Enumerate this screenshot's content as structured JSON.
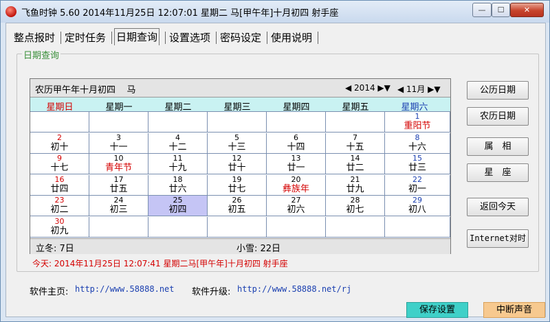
{
  "titlebar": {
    "title": "飞鱼时钟 5.60 2014年11月25日 12:07:01 星期二 马[甲午年]十月初四 射手座",
    "min": "—",
    "max": "☐",
    "close": "✕"
  },
  "tabs": [
    "整点报时",
    "定时任务",
    "日期查询",
    "设置选项",
    "密码设定",
    "使用说明"
  ],
  "active_tab": "日期查询",
  "group_title": "日期查询",
  "calendar": {
    "lunar_header": "农历甲午年十月初四",
    "zodiac": "马",
    "year": "2014",
    "month": "11月",
    "weekdays": [
      "星期日",
      "星期一",
      "星期二",
      "星期三",
      "星期四",
      "星期五",
      "星期六"
    ],
    "rows": [
      [
        null,
        null,
        null,
        null,
        null,
        null,
        {
          "d": "1",
          "l": "重阳节",
          "fest": true
        }
      ],
      [
        {
          "d": "2",
          "l": "初十"
        },
        {
          "d": "3",
          "l": "十一"
        },
        {
          "d": "4",
          "l": "十二"
        },
        {
          "d": "5",
          "l": "十三"
        },
        {
          "d": "6",
          "l": "十四"
        },
        {
          "d": "7",
          "l": "十五"
        },
        {
          "d": "8",
          "l": "十六"
        }
      ],
      [
        {
          "d": "9",
          "l": "十七"
        },
        {
          "d": "10",
          "l": "青年节",
          "fest": true
        },
        {
          "d": "11",
          "l": "十九"
        },
        {
          "d": "12",
          "l": "廿十"
        },
        {
          "d": "13",
          "l": "廿一"
        },
        {
          "d": "14",
          "l": "廿二"
        },
        {
          "d": "15",
          "l": "廿三"
        }
      ],
      [
        {
          "d": "16",
          "l": "廿四"
        },
        {
          "d": "17",
          "l": "廿五"
        },
        {
          "d": "18",
          "l": "廿六"
        },
        {
          "d": "19",
          "l": "廿七"
        },
        {
          "d": "20",
          "l": "彝族年",
          "fest": true
        },
        {
          "d": "21",
          "l": "廿九"
        },
        {
          "d": "22",
          "l": "初一"
        }
      ],
      [
        {
          "d": "23",
          "l": "初二"
        },
        {
          "d": "24",
          "l": "初三"
        },
        {
          "d": "25",
          "l": "初四",
          "sel": true
        },
        {
          "d": "26",
          "l": "初五"
        },
        {
          "d": "27",
          "l": "初六"
        },
        {
          "d": "28",
          "l": "初七"
        },
        {
          "d": "29",
          "l": "初八"
        }
      ],
      [
        {
          "d": "30",
          "l": "初九"
        },
        null,
        null,
        null,
        null,
        null,
        null
      ]
    ],
    "solar_term_1": "立冬: 7日",
    "solar_term_2": "小雪: 22日"
  },
  "today": "今天: 2014年11月25日 12:07:41 星期二马[甲午年]十月初四 射手座",
  "side_buttons": [
    "公历日期",
    "农历日期",
    "属　相",
    "星　座",
    "返回今天",
    "Internet对时"
  ],
  "footer": {
    "homepage_label": "软件主页:",
    "homepage_url": "http://www.58888.net",
    "upgrade_label": "软件升级:",
    "upgrade_url": "http://www.58888.net/rj",
    "save": "保存设置",
    "mute": "中断声音"
  },
  "colors": {
    "weekday_header": "#c9f2f2",
    "selected_day": "#c5c5f5",
    "festival": "#d40000",
    "sunday": "#d40000",
    "saturday": "#1a3fb0",
    "save_button": "#3fd0c8",
    "mute_button": "#f7c98f"
  }
}
